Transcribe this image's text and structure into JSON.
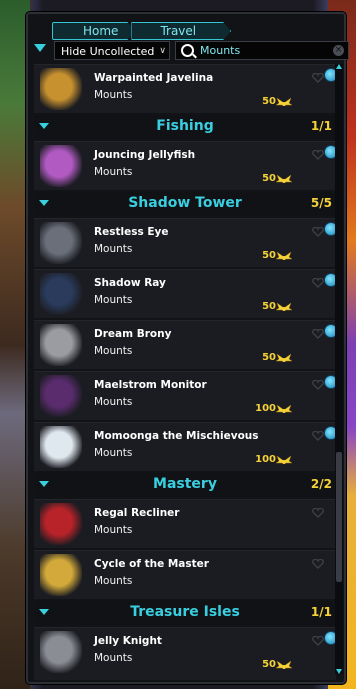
{
  "breadcrumb": {
    "home": "Home",
    "travel": "Travel"
  },
  "filter": {
    "selected": "Hide Uncollected",
    "options_caret": "∨"
  },
  "search": {
    "value": "Mounts",
    "clear": "×"
  },
  "items_top": [
    {
      "name": "Warpainted Javelina",
      "type": "Mounts",
      "price": "50",
      "icon": "javelina-icon",
      "color": "#c8912f"
    }
  ],
  "sections": [
    {
      "title": "Fishing",
      "count": "1/1",
      "items": [
        {
          "name": "Jouncing Jellyfish",
          "type": "Mounts",
          "price": "50",
          "icon": "jellyfish-icon",
          "color": "#b05ac2"
        }
      ]
    },
    {
      "title": "Shadow Tower",
      "count": "5/5",
      "items": [
        {
          "name": "Restless Eye",
          "type": "Mounts",
          "price": "50",
          "icon": "eye-icon",
          "color": "#6a6f7a"
        },
        {
          "name": "Shadow Ray",
          "type": "Mounts",
          "price": "50",
          "icon": "ray-icon",
          "color": "#2a3b5c"
        },
        {
          "name": "Dream Brony",
          "type": "Mounts",
          "price": "50",
          "icon": "brony-icon",
          "color": "#9a9ca2"
        },
        {
          "name": "Maelstrom Monitor",
          "type": "Mounts",
          "price": "100",
          "icon": "monitor-icon",
          "color": "#5a2c6e"
        },
        {
          "name": "Momoonga the Mischievous",
          "type": "Mounts",
          "price": "100",
          "icon": "momoonga-icon",
          "color": "#dfe7ef"
        }
      ]
    },
    {
      "title": "Mastery",
      "count": "2/2",
      "items": [
        {
          "name": "Regal Recliner",
          "type": "Mounts",
          "price": "",
          "icon": "recliner-icon",
          "color": "#b8232a"
        },
        {
          "name": "Cycle of the Master",
          "type": "Mounts",
          "price": "",
          "icon": "cycle-icon",
          "color": "#d2a93a"
        }
      ]
    },
    {
      "title": "Treasure Isles",
      "count": "1/1",
      "items": [
        {
          "name": "Jelly Knight",
          "type": "Mounts",
          "price": "50",
          "icon": "knight-icon",
          "color": "#8a8d94"
        }
      ]
    }
  ],
  "colors": {
    "accent": "#38d0dd",
    "gold": "#f5d23a",
    "panel": "#121317",
    "row": "#1b1c21"
  }
}
